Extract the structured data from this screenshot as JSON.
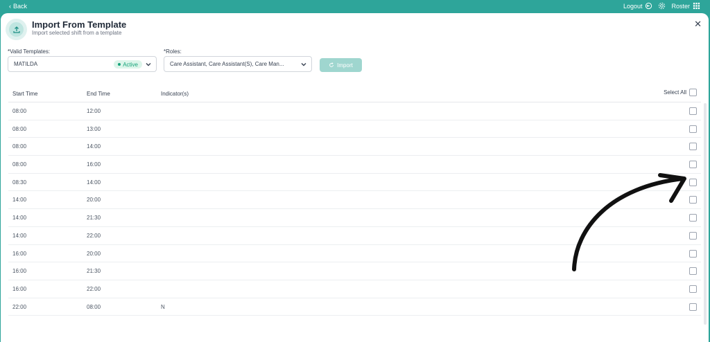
{
  "topbar": {
    "back_label": "Back",
    "logout_label": "Logout",
    "roster_label": "Roster"
  },
  "header": {
    "title": "Import From Template",
    "subtitle": "Import selected shift from a template"
  },
  "form": {
    "templates_label": "*Valid Templates:",
    "template_value": "MATILDA",
    "template_status": "Active",
    "roles_label": "*Roles:",
    "roles_value": "Care Assistant, Care Assistant(S), Care Man...",
    "import_label": "Import"
  },
  "table": {
    "columns": [
      "Start Time",
      "End Time",
      "Indicator(s)"
    ],
    "select_all_label": "Select All",
    "rows": [
      {
        "start": "08:00",
        "end": "12:00",
        "indicator": ""
      },
      {
        "start": "08:00",
        "end": "13:00",
        "indicator": ""
      },
      {
        "start": "08:00",
        "end": "14:00",
        "indicator": ""
      },
      {
        "start": "08:00",
        "end": "16:00",
        "indicator": ""
      },
      {
        "start": "08:30",
        "end": "14:00",
        "indicator": ""
      },
      {
        "start": "14:00",
        "end": "20:00",
        "indicator": ""
      },
      {
        "start": "14:00",
        "end": "21:30",
        "indicator": ""
      },
      {
        "start": "14:00",
        "end": "22:00",
        "indicator": ""
      },
      {
        "start": "16:00",
        "end": "20:00",
        "indicator": ""
      },
      {
        "start": "16:00",
        "end": "21:30",
        "indicator": ""
      },
      {
        "start": "16:00",
        "end": "22:00",
        "indicator": ""
      },
      {
        "start": "22:00",
        "end": "08:00",
        "indicator": "N"
      }
    ]
  },
  "colors": {
    "brand": "#2ea59a",
    "active_badge_bg": "#dcf5ea",
    "active_badge_text": "#16a37a"
  },
  "icons": [
    "chevron-left-icon",
    "logout-icon",
    "gear-icon",
    "grid-icon",
    "upload-icon",
    "close-icon",
    "chevron-down-icon",
    "refresh-icon",
    "arrow-annotation"
  ]
}
